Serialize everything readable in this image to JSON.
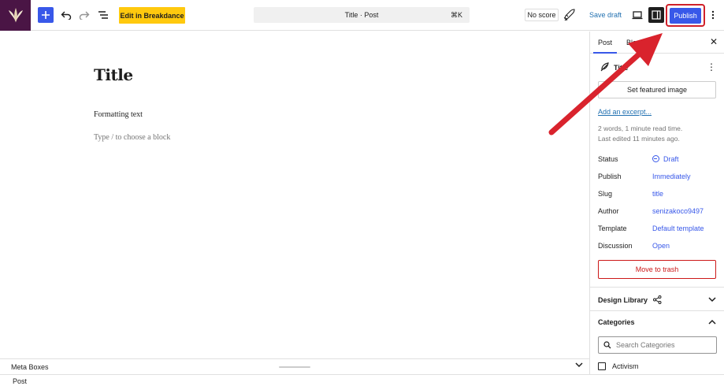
{
  "toolbar": {
    "edit_breakdance_label": "Edit in Breakdance",
    "command_title": "Title · Post",
    "command_shortcut": "⌘K",
    "no_score_label": "No score",
    "save_draft_label": "Save draft",
    "publish_label": "Publish",
    "publish_highlight_color": "#d0202a",
    "accent_color": "#3858e9",
    "icons": [
      "logo-icon",
      "plus-icon",
      "undo-icon",
      "redo-icon",
      "list-view-icon",
      "rocket-icon",
      "desktop-view-icon",
      "sidebar-toggle-icon",
      "options-icon"
    ]
  },
  "editor": {
    "title": "Title",
    "paragraph": "Formatting text",
    "placeholder": "Type / to choose a block"
  },
  "sidebar": {
    "tabs": [
      {
        "label": "Post",
        "active": true
      },
      {
        "label": "Block",
        "active": false
      }
    ],
    "post_title_row": "Title",
    "featured_image_label": "Set featured image",
    "excerpt_label": "Add an excerpt...",
    "read_time": "2 words, 1 minute read time.",
    "last_edited": "Last edited 11 minutes ago.",
    "rows": [
      {
        "label": "Status",
        "value": "Draft"
      },
      {
        "label": "Publish",
        "value": "Immediately"
      },
      {
        "label": "Slug",
        "value": "title"
      },
      {
        "label": "Author",
        "value": "senizakoco9497"
      },
      {
        "label": "Template",
        "value": "Default template"
      },
      {
        "label": "Discussion",
        "value": "Open"
      }
    ],
    "trash_label": "Move to trash",
    "design_library_label": "Design Library",
    "categories_label": "Categories",
    "categories_search_placeholder": "Search Categories",
    "categories": [
      "Activism"
    ]
  },
  "bottom": {
    "meta_boxes_label": "Meta Boxes",
    "status_label": "Post"
  }
}
